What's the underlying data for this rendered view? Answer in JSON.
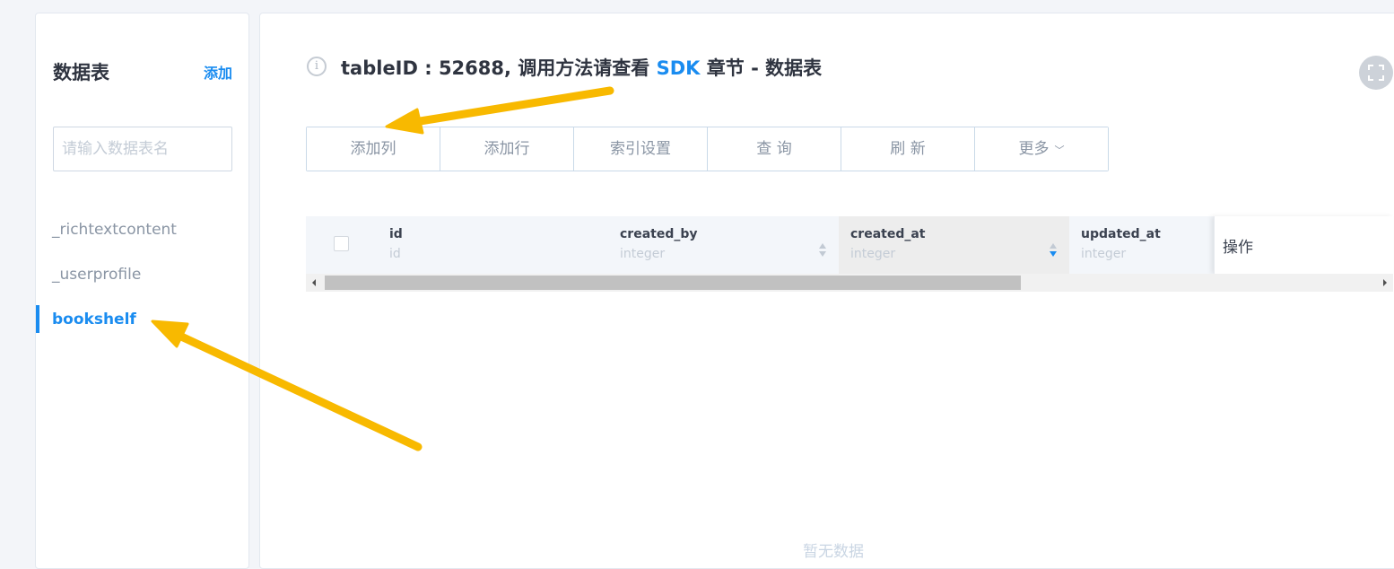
{
  "sidebar": {
    "title": "数据表",
    "add_label": "添加",
    "search": {
      "placeholder": "请输入数据表名",
      "value": ""
    },
    "items": [
      {
        "label": "_richtextcontent",
        "active": false
      },
      {
        "label": "_userprofile",
        "active": false
      },
      {
        "label": "bookshelf",
        "active": true
      }
    ]
  },
  "header": {
    "info_icon_glyph": "i",
    "title_prefix": "tableID : 52688,  调用方法请查看 ",
    "title_link": "SDK",
    "title_suffix": " 章节 - 数据表",
    "fullscreen_icon": "fullscreen-icon"
  },
  "toolbar": {
    "buttons": [
      "添加列",
      "添加行",
      "索引设置",
      "查 询",
      "刷 新"
    ],
    "more_label": "更多",
    "more_icon": "chevron-down-icon"
  },
  "table": {
    "columns": [
      {
        "name": "id",
        "type": "id",
        "sortable": false
      },
      {
        "name": "created_by",
        "type": "integer",
        "sortable": true,
        "sort": "none"
      },
      {
        "name": "created_at",
        "type": "integer",
        "sortable": true,
        "sort": "desc"
      },
      {
        "name": "updated_at",
        "type": "integer",
        "sortable": false
      }
    ],
    "operations_label": "操作",
    "empty_text": "暂无数据"
  },
  "colors": {
    "accent": "#1a8cf0",
    "annotation_arrow": "#f8b900"
  }
}
